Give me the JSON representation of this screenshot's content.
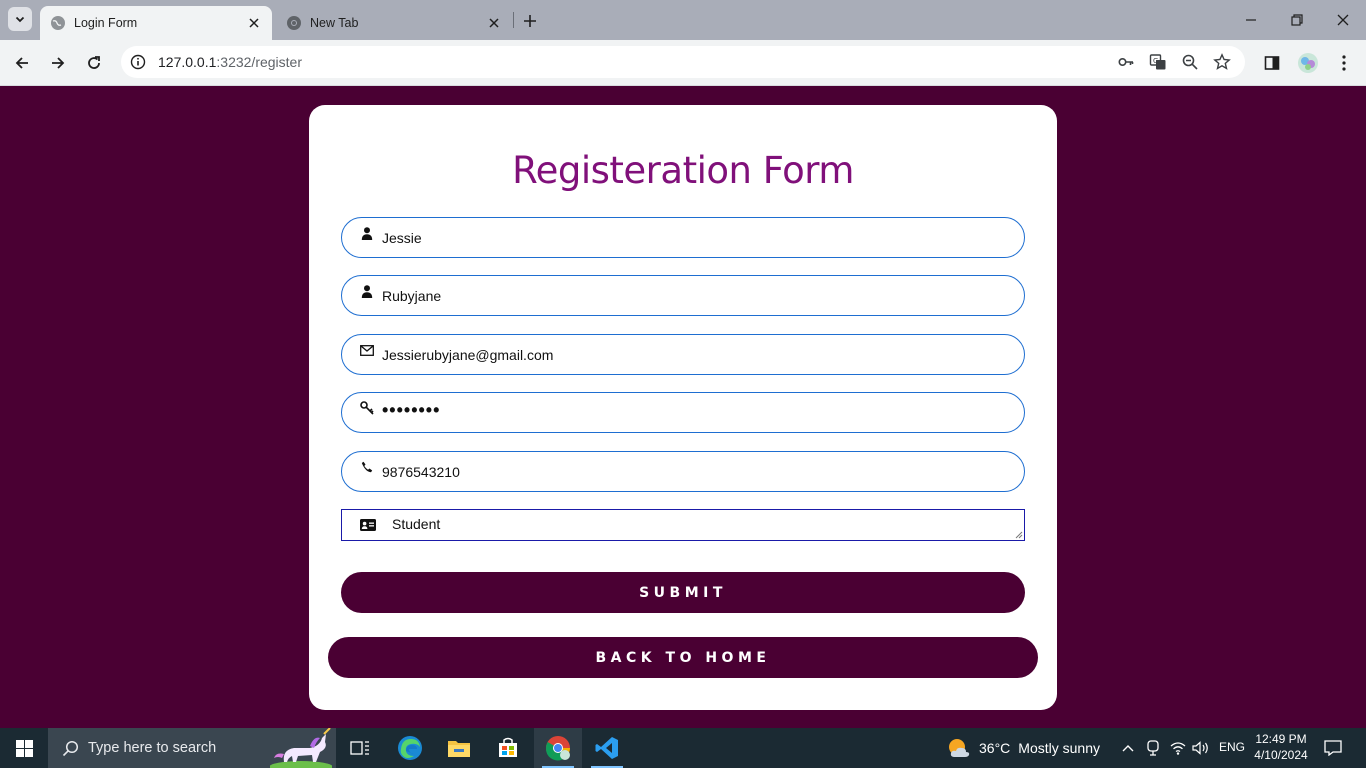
{
  "browser": {
    "tabs": [
      {
        "label": "Login Form",
        "active": true
      },
      {
        "label": "New Tab",
        "active": false
      }
    ],
    "url_host": "127.0.0.1",
    "url_rest": ":3232/register"
  },
  "form": {
    "title": "Registeration Form",
    "fields": {
      "first_name": "Jessie",
      "last_name": "Rubyjane",
      "email": "Jessierubyjane@gmail.com",
      "password_mask": "••••••••",
      "phone": "9876543210",
      "role": "Student"
    },
    "submit_label": "SUBMIT",
    "back_label": "BACK TO HOME"
  },
  "taskbar": {
    "search_placeholder": "Type here to search",
    "weather_temp": "36°C",
    "weather_condition": "Mostly sunny",
    "language": "ENG",
    "time": "12:49 PM",
    "date": "4/10/2024"
  },
  "colors": {
    "page_bg": "#4a0033",
    "title": "#80107a",
    "input_border": "#1e6ed1",
    "button_bg": "#4a0033"
  }
}
